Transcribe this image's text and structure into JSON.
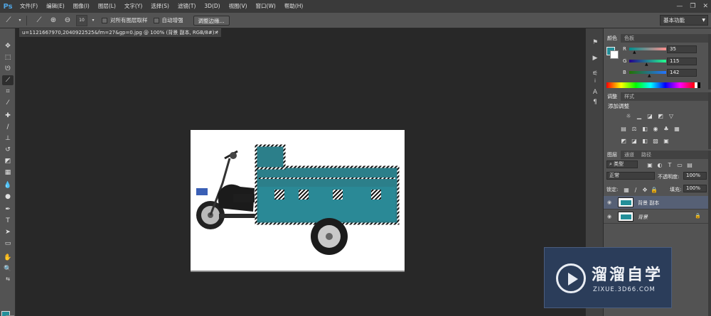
{
  "app": {
    "logo": "Ps"
  },
  "menu": [
    "文件(F)",
    "编辑(E)",
    "图像(I)",
    "图层(L)",
    "文字(Y)",
    "选择(S)",
    "滤镜(T)",
    "3D(D)",
    "视图(V)",
    "窗口(W)",
    "帮助(H)"
  ],
  "window_controls": {
    "minimize": "—",
    "restore": "❐",
    "close": "✕"
  },
  "options": {
    "brush_size": "10",
    "sample_all_layers": "对所有图层取样",
    "auto_enhance": "自动增强",
    "refine_edge": "调整边缘...",
    "workspace": "基本功能"
  },
  "document": {
    "tab_title": "u=1121667970,2040922525&fm=27&gp=0.jpg @ 100% (背景 副本, RGB/8#) *",
    "close": "×"
  },
  "colors": {
    "foreground": "#238f99",
    "background": "#ffffff",
    "accent_selection": "#566075"
  },
  "color_panel": {
    "tabs": [
      "颜色",
      "色板"
    ],
    "channels": [
      {
        "label": "R",
        "value": "35"
      },
      {
        "label": "G",
        "value": "115"
      },
      {
        "label": "B",
        "value": "142"
      }
    ]
  },
  "adjust_panel": {
    "tabs": [
      "调整",
      "样式"
    ],
    "title": "添加调整"
  },
  "layers_panel": {
    "tabs": [
      "图层",
      "通道",
      "路径"
    ],
    "filter": "类型",
    "blend_mode": "正常",
    "opacity_label": "不透明度:",
    "opacity": "100%",
    "lock_label": "锁定:",
    "fill_label": "填充:",
    "fill": "100%",
    "layers": [
      {
        "name": "背景 副本"
      },
      {
        "name": "背景"
      }
    ]
  },
  "watermark": {
    "brand": "溜溜自学",
    "url": "ZIXUE.3D66.COM"
  }
}
